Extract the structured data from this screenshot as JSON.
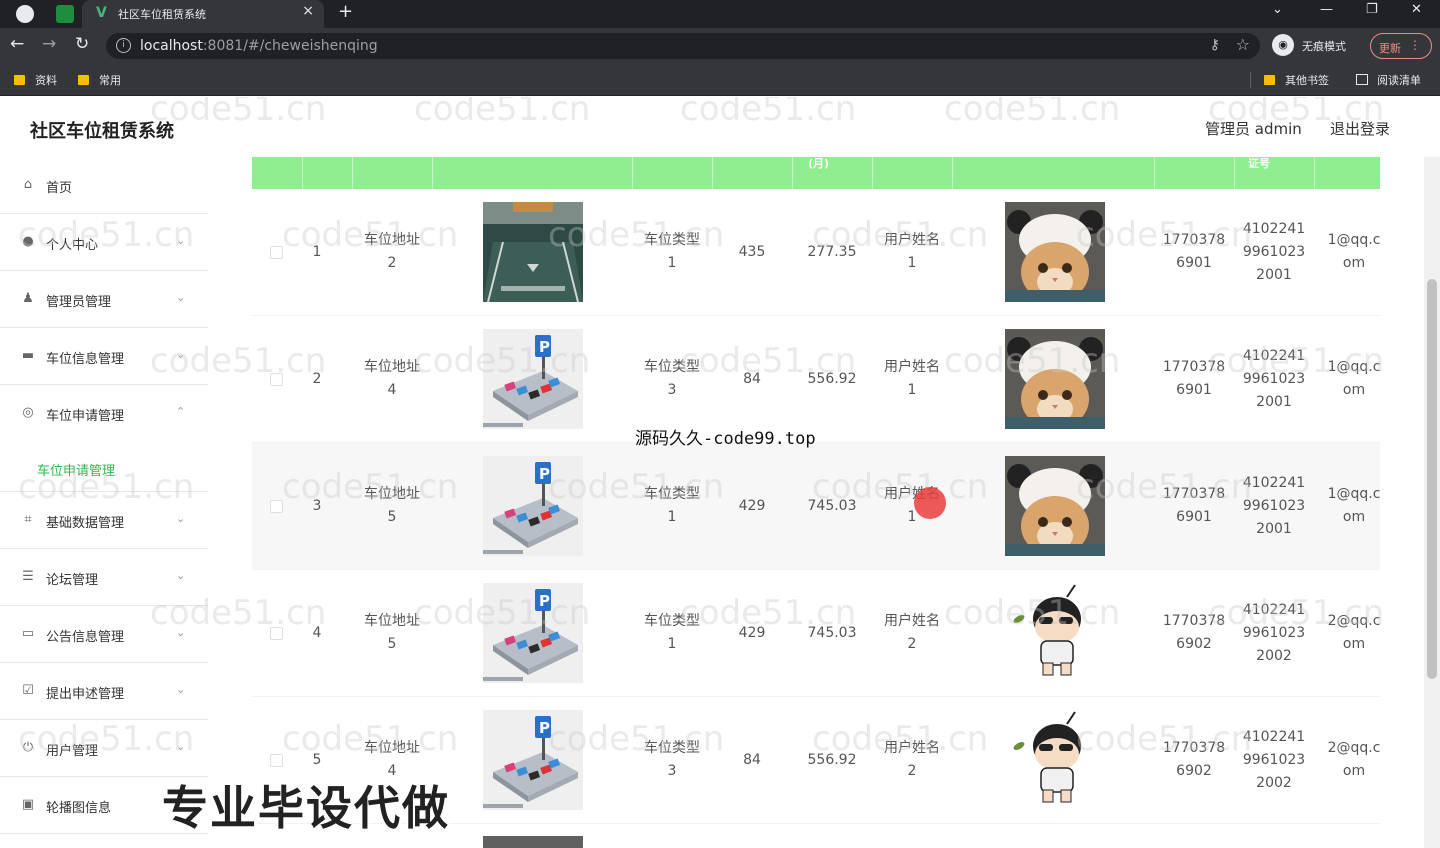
{
  "browser": {
    "tab_title": "社区车位租赁系统",
    "url_host": "localhost",
    "url_rest": ":8081/#/cheweishenqing",
    "incognito_label": "无痕模式",
    "update_label": "更新",
    "bookmarks": [
      "资料",
      "常用",
      "其他书签",
      "阅读清单"
    ]
  },
  "header": {
    "title": "社区车位租赁系统",
    "admin_label": "管理员 admin",
    "logout_label": "退出登录"
  },
  "sidebar": {
    "items": [
      {
        "label": "首页",
        "icon": "home-icon"
      },
      {
        "label": "个人中心",
        "icon": "user-icon"
      },
      {
        "label": "管理员管理",
        "icon": "admin-icon"
      },
      {
        "label": "车位信息管理",
        "icon": "parking-info-icon"
      },
      {
        "label": "车位申请管理",
        "icon": "compass-icon"
      },
      {
        "label": "基础数据管理",
        "icon": "crop-icon"
      },
      {
        "label": "论坛管理",
        "icon": "sliders-icon"
      },
      {
        "label": "公告信息管理",
        "icon": "message-icon"
      },
      {
        "label": "提出申述管理",
        "icon": "checklist-icon"
      },
      {
        "label": "用户管理",
        "icon": "power-icon"
      },
      {
        "label": "轮播图信息",
        "icon": "carousel-icon"
      }
    ],
    "submenu_label": "车位申请管理"
  },
  "table": {
    "header_fragments": [
      "(月)",
      "证号"
    ],
    "rows": [
      {
        "index": "1",
        "address": [
          "车位地址",
          "2"
        ],
        "type": [
          "车位类型",
          "1"
        ],
        "amount": "435",
        "price": "277.35",
        "user": [
          "用户姓名",
          "1"
        ],
        "phone": [
          "1770378",
          "6901"
        ],
        "id_number": [
          "4102241",
          "9961023",
          "2001"
        ],
        "email": [
          "1@qq.c",
          "om"
        ],
        "image": "garage-photo",
        "avatar": "cat-avatar"
      },
      {
        "index": "2",
        "address": [
          "车位地址",
          "4"
        ],
        "type": [
          "车位类型",
          "3"
        ],
        "amount": "84",
        "price": "556.92",
        "user": [
          "用户姓名",
          "1"
        ],
        "phone": [
          "1770378",
          "6901"
        ],
        "id_number": [
          "4102241",
          "9961023",
          "2001"
        ],
        "email": [
          "1@qq.c",
          "om"
        ],
        "image": "parking-illustration",
        "avatar": "cat-avatar"
      },
      {
        "index": "3",
        "address": [
          "车位地址",
          "5"
        ],
        "type": [
          "车位类型",
          "1"
        ],
        "amount": "429",
        "price": "745.03",
        "user": [
          "用户姓名",
          "1"
        ],
        "phone": [
          "1770378",
          "6901"
        ],
        "id_number": [
          "4102241",
          "9961023",
          "2001"
        ],
        "email": [
          "1@qq.c",
          "om"
        ],
        "image": "parking-illustration",
        "avatar": "cat-avatar"
      },
      {
        "index": "4",
        "address": [
          "车位地址",
          "5"
        ],
        "type": [
          "车位类型",
          "1"
        ],
        "amount": "429",
        "price": "745.03",
        "user": [
          "用户姓名",
          "2"
        ],
        "phone": [
          "1770378",
          "6902"
        ],
        "id_number": [
          "4102241",
          "9961023",
          "2002"
        ],
        "email": [
          "2@qq.c",
          "om"
        ],
        "image": "parking-illustration",
        "avatar": "cartoon-avatar"
      },
      {
        "index": "5",
        "address": [
          "车位地址",
          "4"
        ],
        "type": [
          "车位类型",
          "3"
        ],
        "amount": "84",
        "price": "556.92",
        "user": [
          "用户姓名",
          "2"
        ],
        "phone": [
          "1770378",
          "6902"
        ],
        "id_number": [
          "4102241",
          "9961023",
          "2002"
        ],
        "email": [
          "2@qq.c",
          "om"
        ],
        "image": "parking-illustration",
        "avatar": "cartoon-avatar"
      }
    ]
  },
  "overlays": {
    "watermark": "code51.cn",
    "promo_text": "源码久久-code99.top",
    "promo_bottom": "专业毕设代做"
  },
  "colors": {
    "table_header": "#90ee90",
    "submenu_active": "#2db84d",
    "browser_dark": "#35363a"
  }
}
